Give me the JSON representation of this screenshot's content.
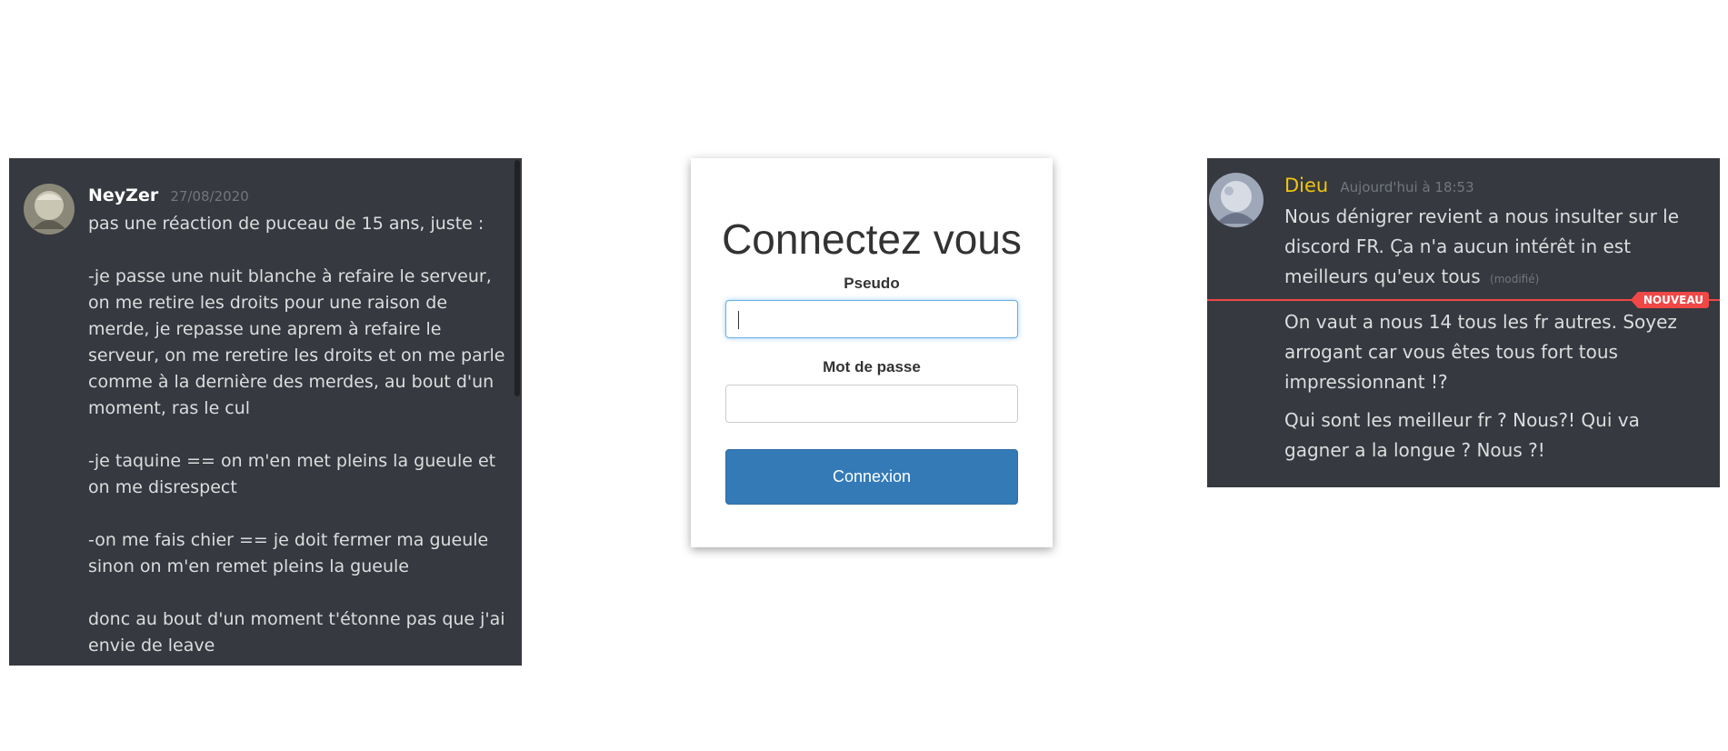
{
  "left_chat": {
    "username": "NeyZer",
    "timestamp": "27/08/2020",
    "paragraphs": [
      "pas une réaction de puceau de 15 ans, juste :",
      "-je passe une nuit blanche à refaire le serveur, on me retire les droits pour une raison de merde, je repasse une aprem à refaire le serveur, on me reretire les droits et on me parle comme à la dernière des merdes, au bout d'un moment, ras le cul",
      "-je taquine == on m'en met pleins la gueule et on me disrespect",
      "-on me fais chier == je doit fermer ma gueule sinon on m'en remet pleins la gueule",
      "donc au bout d'un moment t'étonne pas que j'ai envie de leave"
    ],
    "avatar_icon": "avatar-icon"
  },
  "login": {
    "title": "Connectez vous",
    "username_label": "Pseudo",
    "username_value": "",
    "password_label": "Mot de passe",
    "password_value": "",
    "submit_label": "Connexion",
    "button_color": "#337ab7"
  },
  "right_chat": {
    "username": "Dieu",
    "username_color": "#f1c40f",
    "timestamp": "Aujourd'hui à 18:53",
    "message1": "Nous dénigrer revient a nous insulter sur le discord FR. Ça n'a aucun intérêt in est meilleurs qu'eux tous",
    "edited_label": "(modifié)",
    "new_badge": "NOUVEAU",
    "message2": "On vaut a nous 14 tous les fr autres. Soyez arrogant car vous êtes tous fort tous impressionnant !?",
    "message3": "Qui sont les meilleur fr ? Nous?! Qui va gagner a la longue ? Nous ?!",
    "avatar_icon": "avatar-icon"
  },
  "colors": {
    "discord_bg": "#36393f",
    "new_divider": "#f04747"
  }
}
